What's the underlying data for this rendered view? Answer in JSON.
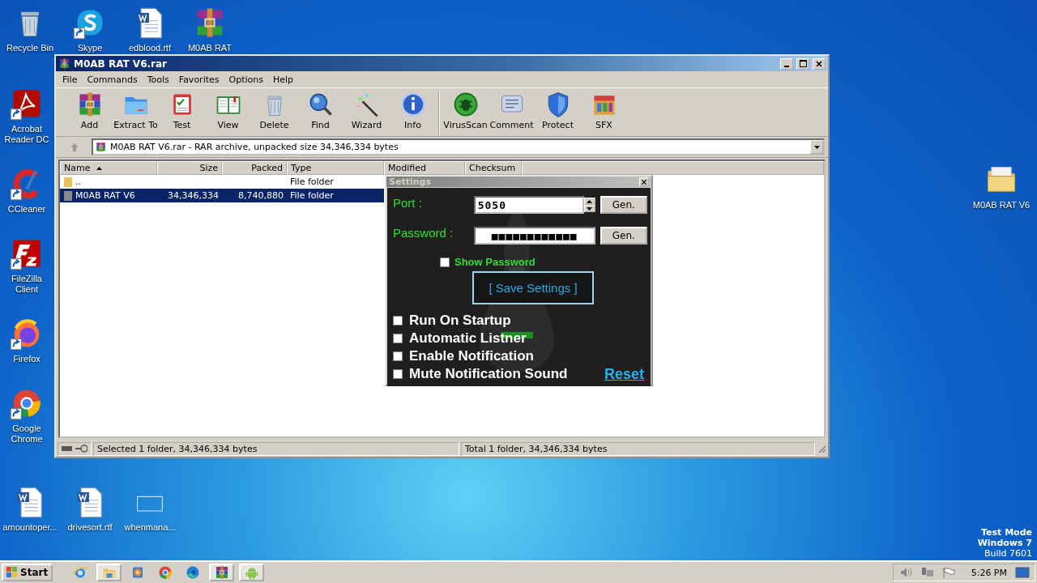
{
  "desktop": {
    "top_icons": [
      {
        "label": "Recycle Bin",
        "kind": "bin",
        "shortcut": false
      },
      {
        "label": "Skype",
        "kind": "skype",
        "shortcut": true
      },
      {
        "label": "edblood.rtf",
        "kind": "word",
        "shortcut": false
      },
      {
        "label": "M0AB RAT",
        "kind": "winrar",
        "shortcut": false
      }
    ],
    "left_icons": [
      {
        "label": "Acrobat Reader DC",
        "kind": "acrobat",
        "shortcut": true
      },
      {
        "label": "CCleaner",
        "kind": "ccleaner",
        "shortcut": true
      },
      {
        "label": "FileZilla Client",
        "kind": "filezilla",
        "shortcut": true
      },
      {
        "label": "Firefox",
        "kind": "firefox",
        "shortcut": true
      },
      {
        "label": "Google Chrome",
        "kind": "chrome",
        "shortcut": true
      }
    ],
    "bottom_icons": [
      {
        "label": "amountoper...",
        "kind": "word",
        "shortcut": false
      },
      {
        "label": "drivesort.rtf",
        "kind": "word",
        "shortcut": false
      },
      {
        "label": "whenmana...",
        "kind": "blank",
        "shortcut": false
      }
    ],
    "right_icons": [
      {
        "label": "M0AB RAT V6",
        "kind": "folder",
        "shortcut": false
      }
    ],
    "os_notice": [
      "Test Mode",
      "Windows 7",
      "Build 7601"
    ]
  },
  "winrar": {
    "title": "M0AB RAT V6.rar",
    "menu": [
      "File",
      "Commands",
      "Tools",
      "Favorites",
      "Options",
      "Help"
    ],
    "toolbar": [
      {
        "label": "Add",
        "kind": "winrar"
      },
      {
        "label": "Extract To",
        "kind": "folder-blue"
      },
      {
        "label": "Test",
        "kind": "test"
      },
      {
        "label": "View",
        "kind": "book"
      },
      {
        "label": "Delete",
        "kind": "bin"
      },
      {
        "label": "Find",
        "kind": "find"
      },
      {
        "label": "Wizard",
        "kind": "wand"
      },
      {
        "label": "Info",
        "kind": "info"
      },
      {
        "label": "VirusScan",
        "kind": "bug"
      },
      {
        "label": "Comment",
        "kind": "comment"
      },
      {
        "label": "Protect",
        "kind": "shield"
      },
      {
        "label": "SFX",
        "kind": "box"
      }
    ],
    "address": "M0AB RAT V6.rar - RAR archive, unpacked size 34,346,334 bytes",
    "columns": [
      "Name",
      "Size",
      "Packed",
      "Type",
      "Modified",
      "Checksum"
    ],
    "rows": [
      {
        "name": "..",
        "type": "File folder",
        "selected": false
      },
      {
        "name": "M0AB RAT V6",
        "size": "34,346,334",
        "packed": "8,740,880",
        "type": "File folder",
        "selected": true
      }
    ],
    "status_left": "Selected 1 folder, 34,346,334 bytes",
    "status_right": "Total 1 folder, 34,346,334 bytes"
  },
  "settings": {
    "title": "Settings",
    "port_label": "Port :",
    "port_value": "5050",
    "password_label": "Password :",
    "password_value": "■■■■■■■■■■■■",
    "gen_buttons": [
      "Gen.",
      "Gen."
    ],
    "show_password": {
      "label": "Show Password",
      "checked": false
    },
    "save_button": "[ Save Settings ]",
    "options": [
      {
        "label": "Run On Startup",
        "checked": false
      },
      {
        "label": "Automatic Listner",
        "checked": false
      },
      {
        "label": "Enable Notification",
        "checked": false
      },
      {
        "label": "Mute Notification Sound",
        "checked": false
      }
    ],
    "reset_link": "Reset"
  },
  "taskbar": {
    "start": "Start",
    "apps": [
      {
        "kind": "ie",
        "active": false
      },
      {
        "kind": "explorer",
        "active": true
      },
      {
        "kind": "media",
        "active": false
      },
      {
        "kind": "chrome",
        "active": false
      },
      {
        "kind": "edge",
        "active": false
      },
      {
        "kind": "winrar",
        "active": true
      },
      {
        "kind": "android",
        "active": true
      }
    ],
    "clock": "5:26 PM"
  }
}
